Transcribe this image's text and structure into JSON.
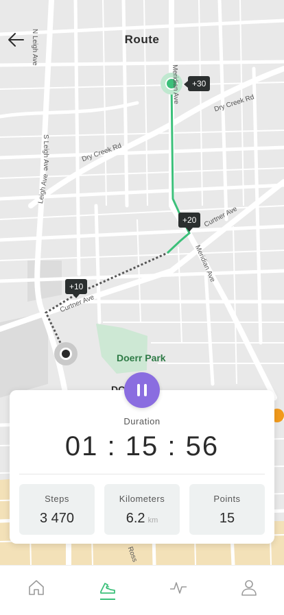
{
  "header": {
    "title": "Route"
  },
  "map": {
    "streets": [
      "N Leigh Ave",
      "S Leigh Ave",
      "Leigh Ave",
      "Dry Creek Rd",
      "Dry Creek Rd",
      "Meridian Ave",
      "Meridian Ave",
      "Curtner Ave",
      "Curtner Ave",
      "Ross"
    ],
    "park": "Doerr Park",
    "partial_label": "DC",
    "markers": [
      "+10",
      "+20",
      "+30"
    ],
    "route_color": "#3cc07a"
  },
  "workout": {
    "duration_label": "Duration",
    "duration_value": "01 : 15 : 56",
    "stats": [
      {
        "label": "Steps",
        "value": "3 470",
        "unit": ""
      },
      {
        "label": "Kilometers",
        "value": "6.2",
        "unit": "km"
      },
      {
        "label": "Points",
        "value": "15",
        "unit": ""
      }
    ]
  },
  "colors": {
    "accent": "#8a6de0",
    "route": "#3cc07a",
    "track_done": "#555555"
  },
  "tabs": [
    {
      "name": "home",
      "icon": "home-icon"
    },
    {
      "name": "activity",
      "icon": "running-shoe-icon",
      "active": true
    },
    {
      "name": "stats",
      "icon": "pulse-icon"
    },
    {
      "name": "profile",
      "icon": "user-icon"
    }
  ]
}
